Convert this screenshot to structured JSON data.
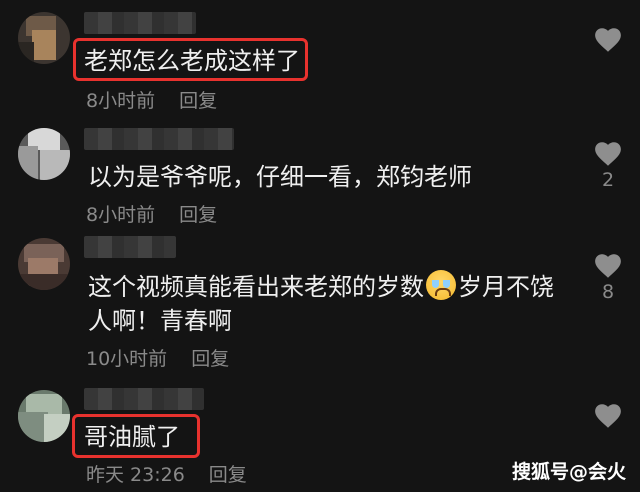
{
  "comments": [
    {
      "text": "老郑怎么老成这样了",
      "time": "8小时前",
      "reply": "回复",
      "like_count": "",
      "highlighted": true
    },
    {
      "text": "以为是爷爷呢，仔细一看，郑钧老师",
      "time": "8小时前",
      "reply": "回复",
      "like_count": "2",
      "highlighted": false
    },
    {
      "text_line1_a": "这个视频真能看出来老郑的岁数",
      "text_line1_b": "岁月不饶",
      "text_line2": "人啊！青春啊",
      "emoji": "crying-face-emoji",
      "time": "10小时前",
      "reply": "回复",
      "like_count": "8",
      "highlighted": false
    },
    {
      "text": "哥油腻了",
      "time": "昨天 23:26",
      "reply": "回复",
      "like_count": "",
      "highlighted": true
    }
  ],
  "watermark": "搜狐号@会火",
  "colors": {
    "background": "#141414",
    "highlight_border": "#e8322e",
    "meta_text": "#8a8a8a",
    "heart_icon": "#8e8e8e"
  },
  "icons": {
    "like": "heart-icon"
  }
}
